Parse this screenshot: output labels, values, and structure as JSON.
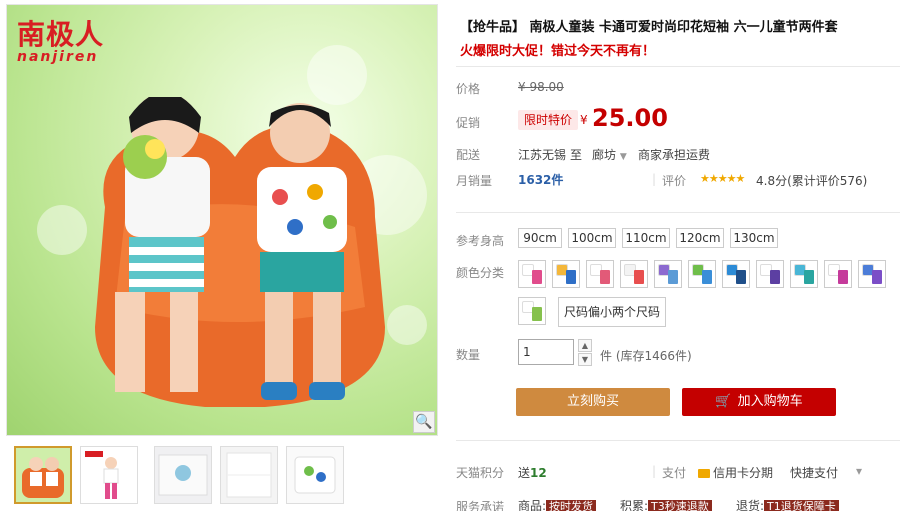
{
  "brand": {
    "logo_cn": "南极人",
    "logo_en": "nanjiren"
  },
  "product": {
    "title": "【抢牛品】 南极人童装 卡通可爱时尚印花短袖 六一儿童节两件套",
    "subtitle": "火爆限时大促！错过今天不再有！"
  },
  "price": {
    "label": "价格",
    "original": "¥ 98.00",
    "promo_label": "促销",
    "promo_badge": "限时特价",
    "currency": "¥",
    "current": "25.00"
  },
  "shipping": {
    "label": "配送",
    "from": "江苏无锡",
    "to_word": "至",
    "destination": "廊坊",
    "note": "商家承担运费"
  },
  "sales": {
    "label": "月销量",
    "count": "1632件",
    "rating_label": "评价",
    "stars": "★★★★★",
    "rating_text": "4.8分(累计评价576)"
  },
  "sizes": {
    "label": "参考身高",
    "options": [
      "90cm",
      "100cm",
      "110cm",
      "120cm",
      "130cm"
    ]
  },
  "colors": {
    "label": "颜色分类",
    "swatches": [
      {
        "shirt": "#ffffff",
        "pants": "#e14c8c"
      },
      {
        "shirt": "#f4b73a",
        "pants": "#2f6fc7"
      },
      {
        "shirt": "#ffffff",
        "pants": "#e25a78"
      },
      {
        "shirt": "#f3f3f3",
        "pants": "#e84f4f"
      },
      {
        "shirt": "#8c6ad0",
        "pants": "#5b9bd6"
      },
      {
        "shirt": "#6fbe4a",
        "pants": "#3a8ed8"
      },
      {
        "shirt": "#2c8bd6",
        "pants": "#1f4f8a"
      },
      {
        "shirt": "#ffffff",
        "pants": "#5c3fa2"
      },
      {
        "shirt": "#49b6d6",
        "pants": "#2aa5a0"
      },
      {
        "shirt": "#ffffff",
        "pants": "#c53b9b"
      },
      {
        "shirt": "#4c7dd8",
        "pants": "#7b4ec7"
      },
      {
        "shirt": "#ffffff",
        "pants": "#86c14d"
      }
    ],
    "text_option": "尺码偏小两个尺码"
  },
  "quantity": {
    "label": "数量",
    "value": "1",
    "unit_stock": "件 (库存1466件)"
  },
  "actions": {
    "buy_now": "立刻购买",
    "add_to_cart": "加入购物车",
    "cart_icon": "🛒"
  },
  "extras": {
    "points_label": "天猫积分",
    "points_prefix": "送",
    "points_value": "12",
    "pay_label": "支付",
    "pay_credit": "信用卡分期",
    "pay_fast": "快捷支付",
    "pay_more": "▾",
    "service_label": "服务承诺",
    "svc1_prefix": "商品:",
    "svc1_tag": "按时发货",
    "svc2_prefix": "积累:",
    "svc2_tag": "T3秒速退款",
    "svc3_prefix": "退货:",
    "svc3_tag": "T1退货保障卡"
  },
  "ui": {
    "zoom_icon": "🔍"
  }
}
